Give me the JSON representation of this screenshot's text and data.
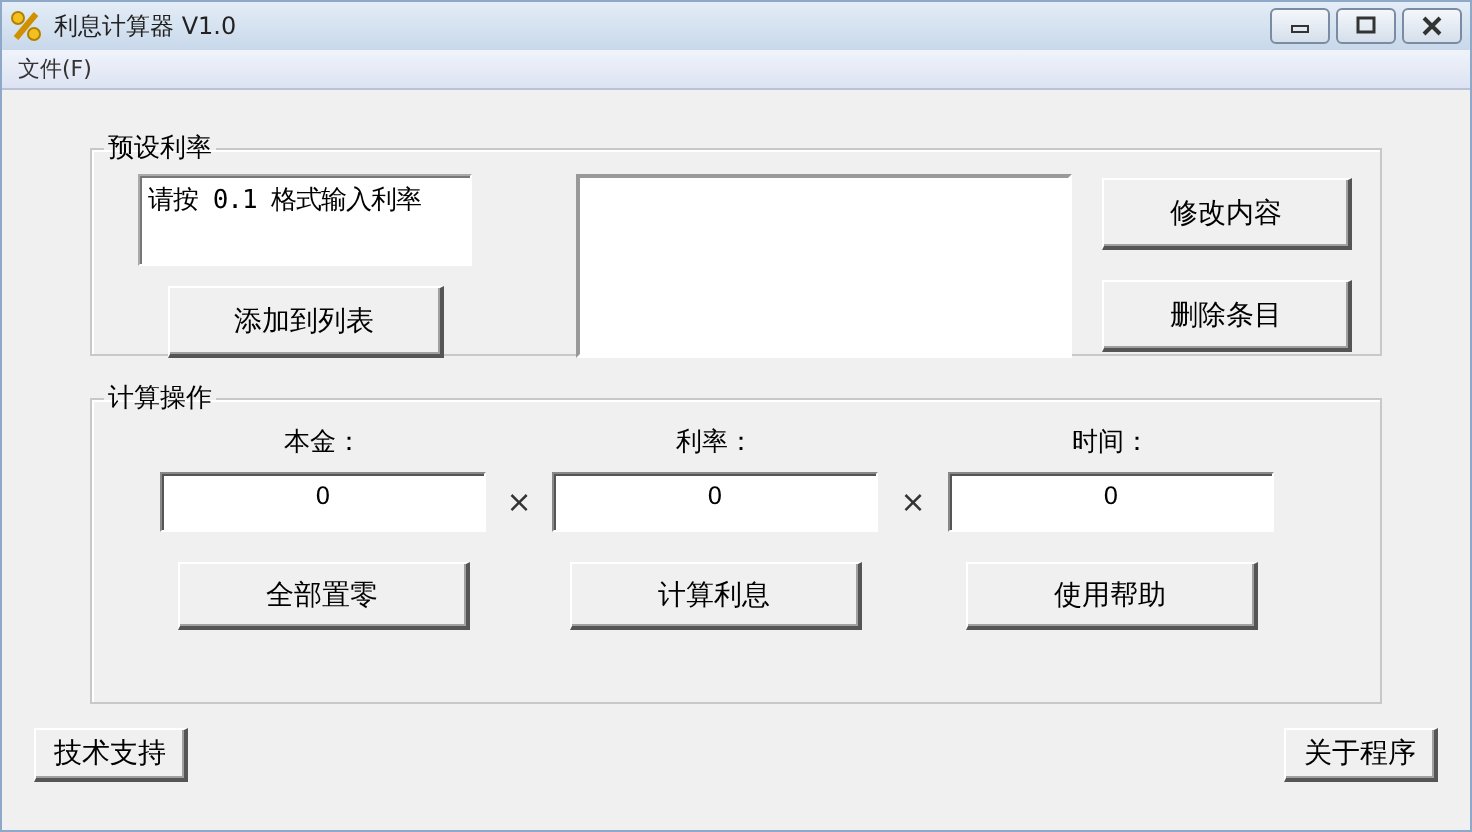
{
  "window": {
    "title": "利息计算器 V1.0"
  },
  "menu": [
    "文件(F)"
  ],
  "preset_group": {
    "title": "预设利率",
    "rate_input": {
      "value": "请按 0.1 格式输入利率"
    },
    "add_button": "添加到列表",
    "buttons": [
      "修改内容",
      "删除条目"
    ]
  },
  "calc_group": {
    "title": "计算操作",
    "fields": [
      {
        "label": "本金：",
        "value": "0"
      },
      {
        "label": "利率：",
        "value": "0"
      },
      {
        "label": "时间：",
        "value": "0"
      }
    ],
    "operators": [
      "×",
      "×"
    ],
    "buttons": [
      "全部置零",
      "计算利息",
      "使用帮助"
    ]
  },
  "footer_buttons": [
    "技术支持",
    "关于程序"
  ]
}
